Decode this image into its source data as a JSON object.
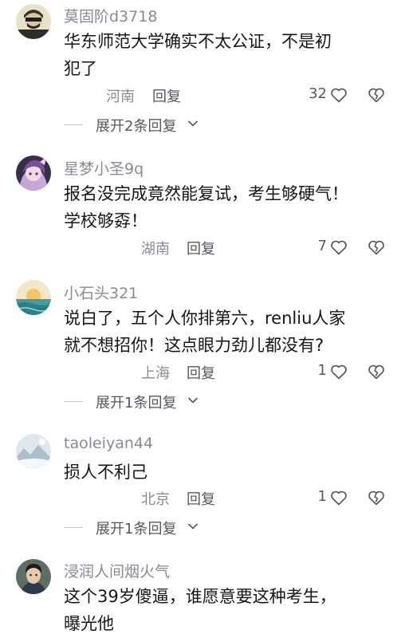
{
  "comments": [
    {
      "username": "莫固阶d3718",
      "lines": [
        "华东师范大学确实不太公证，不是初",
        "犯了"
      ],
      "location": "河南",
      "reply": "回复",
      "likes": "32",
      "expand": "展开2条回复",
      "avatar_icon": "masked-person-avatar"
    },
    {
      "username": "星梦小圣9q",
      "lines": [
        "报名没完成竟然能复试，考生够硬气！",
        "学校够孬！"
      ],
      "location": "湖南",
      "reply": "回复",
      "likes": "7",
      "expand": "",
      "avatar_icon": "anime-character-avatar"
    },
    {
      "username": "小石头321",
      "lines": [
        "说白了，五个人你排第六，renliu人家",
        "就不想招你！这点眼力劲儿都没有?"
      ],
      "location": "上海",
      "reply": "回复",
      "likes": "1",
      "expand": "展开1条回复",
      "avatar_icon": "sunset-sea-avatar"
    },
    {
      "username": "taoleiyan44",
      "lines": [
        "损人不利己"
      ],
      "location": "北京",
      "reply": "回复",
      "likes": "1",
      "expand": "展开1条回复",
      "avatar_icon": "snowy-landscape-avatar"
    },
    {
      "username": "浸润人间烟火气",
      "lines": [
        "这个39岁傻逼，谁愿意要这种考生，",
        "曝光他"
      ],
      "location": "",
      "reply": "",
      "likes": "",
      "expand": "",
      "avatar_icon": "young-man-avatar"
    }
  ],
  "icons": {
    "like": "heart-outline-icon",
    "dislike": "broken-heart-icon",
    "expand": "chevron-down-icon"
  },
  "colors": {
    "username": "#8a8a96",
    "text": "#15161b",
    "secondary": "#57585f"
  }
}
